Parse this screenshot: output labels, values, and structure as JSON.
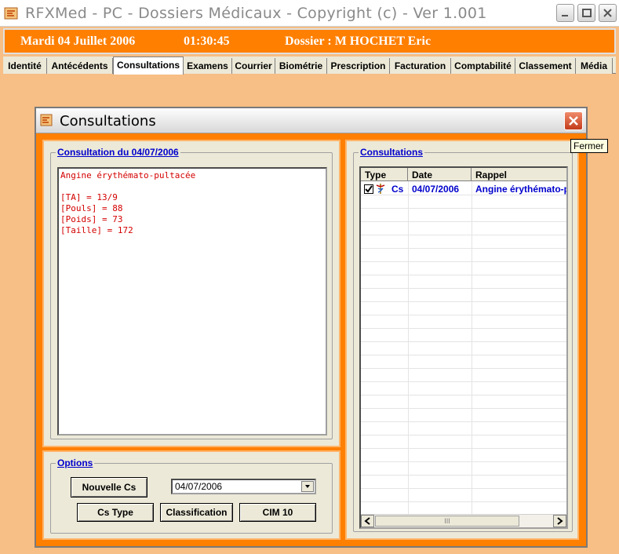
{
  "window": {
    "title": "RFXMed - PC - Dossiers Médicaux - Copyright (c)  - Ver 1.001"
  },
  "header": {
    "date": "Mardi 04 Juillet 2006",
    "time": "01:30:45",
    "dossier": "Dossier : M HOCHET Eric"
  },
  "tabs": [
    {
      "label": "Identité"
    },
    {
      "label": "Antécédents"
    },
    {
      "label": "Consultations"
    },
    {
      "label": "Examens"
    },
    {
      "label": "Courrier"
    },
    {
      "label": "Biométrie"
    },
    {
      "label": "Prescription"
    },
    {
      "label": "Facturation"
    },
    {
      "label": "Comptabilité"
    },
    {
      "label": "Classement"
    },
    {
      "label": "Média"
    }
  ],
  "dialog": {
    "title": "Consultations",
    "close_tooltip": "Fermer",
    "consultation_group_title": "Consultation du 04/07/2006",
    "consultation_text": "Angine érythémato-pultacée\n\n[TA] = 13/9\n[Pouls] = 88\n[Poids] = 73\n[Taille] = 172",
    "options": {
      "group_title": "Options",
      "nouvelle_cs": "Nouvelle Cs",
      "date_select_value": "04/07/2006",
      "cs_type": "Cs Type",
      "classification": "Classification",
      "cim10": "CIM 10"
    },
    "list": {
      "group_title": "Consultations",
      "columns": [
        "Type",
        "Date",
        "Rappel"
      ],
      "rows": [
        {
          "checked": true,
          "type": "Cs",
          "date": "04/07/2006",
          "rappel": "Angine érythémato-pultacée"
        }
      ],
      "scroll_thumb_glyph": "III"
    }
  }
}
